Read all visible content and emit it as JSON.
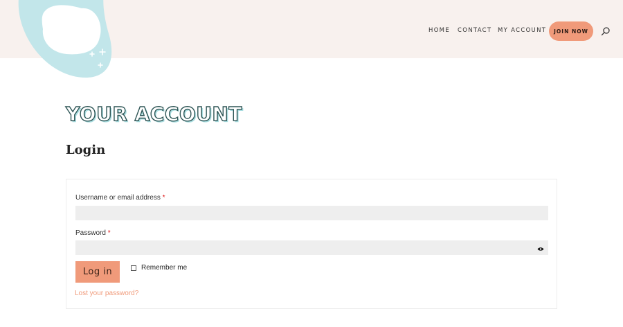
{
  "header": {
    "nav": {
      "home": "HOME",
      "contact": "CONTACT",
      "my_account": "MY ACCOUNT",
      "join_now": "JOIN NOW"
    },
    "search_icon": "search-icon",
    "colors": {
      "header_bg": "#f8f1ee",
      "accent": "#f09a7a",
      "logo_blob": "#c2e6ea"
    }
  },
  "main": {
    "page_title": "YOUR ACCOUNT",
    "login_heading": "Login",
    "form": {
      "username_label": "Username or email address",
      "password_label": "Password",
      "required_marker": "*",
      "username_value": "",
      "password_value": "",
      "login_button": "Log in",
      "remember_label": "Remember me",
      "remember_checked": false,
      "lost_password": "Lost your password?",
      "show_password_icon": "eye-icon"
    }
  }
}
